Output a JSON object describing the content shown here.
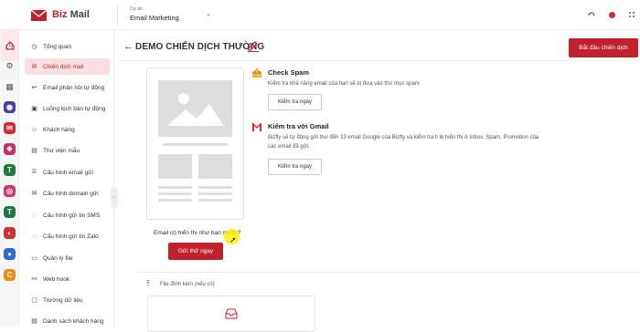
{
  "app": {
    "logo_prefix": "Biz",
    "logo_suffix": "Mail",
    "workspace_label": "Dự án",
    "workspace_value": "Email Marketing"
  },
  "sidebar": {
    "items": [
      {
        "label": "Tổng quan",
        "icon": "clock-icon",
        "active": false
      },
      {
        "label": "Chiến dịch mail",
        "icon": "mail-icon",
        "active": true
      },
      {
        "label": "Email phản hồi tự động",
        "icon": "reply-icon",
        "active": false
      },
      {
        "label": "Luồng kịch bản tự động",
        "icon": "flow-icon",
        "active": false
      },
      {
        "label": "Khách hàng",
        "icon": "users-icon",
        "active": false
      },
      {
        "label": "Thư viện mẫu",
        "icon": "library-icon",
        "active": false
      },
      {
        "label": "Cấu hình email gửi",
        "icon": "send-config-icon",
        "active": false
      },
      {
        "label": "Cấu hình domain gửi",
        "icon": "domain-icon",
        "active": false
      },
      {
        "label": "Cấu hình gửi tin SMS",
        "icon": "sms-icon",
        "active": false
      },
      {
        "label": "Cấu hình gửi tin Zalo",
        "icon": "zalo-icon",
        "active": false
      },
      {
        "label": "Quản lý file",
        "icon": "folder-icon",
        "active": false
      },
      {
        "label": "Web hook",
        "icon": "webhook-icon",
        "active": false
      },
      {
        "label": "Trường dữ liệu",
        "icon": "field-icon",
        "active": false
      },
      {
        "label": "Danh sách khách hàng",
        "icon": "list-icon",
        "active": false
      }
    ]
  },
  "header": {
    "title": "DEMO CHIẾN DỊCH THƯỜNG",
    "start_button": "Bắt đầu chiến dịch"
  },
  "preview": {
    "question": "Email có hiển thị như bạn muốn?",
    "send_test_button": "Gửi thử ngay"
  },
  "checks": [
    {
      "title": "Check Spam",
      "description": "Kiểm tra khả năng email của bạn sẽ bị đưa vào thư mục spam",
      "button": "Kiểm tra ngay"
    },
    {
      "title": "Kiểm tra với Gmail",
      "description_line1": "Bizfly sẽ tự động gửi thư đến 13 email Google của Bizfly và kiểm tra ti lệ hiển thị ở Inbox, Spam, Promotion của",
      "description_line2": "các email đã gửi.",
      "button": "Kiểm tra ngay"
    }
  ],
  "attachment": {
    "label": "File đính kèm (nếu có)"
  },
  "colors": {
    "brand": "#c0222b",
    "active_bg": "#f8dfe1"
  }
}
